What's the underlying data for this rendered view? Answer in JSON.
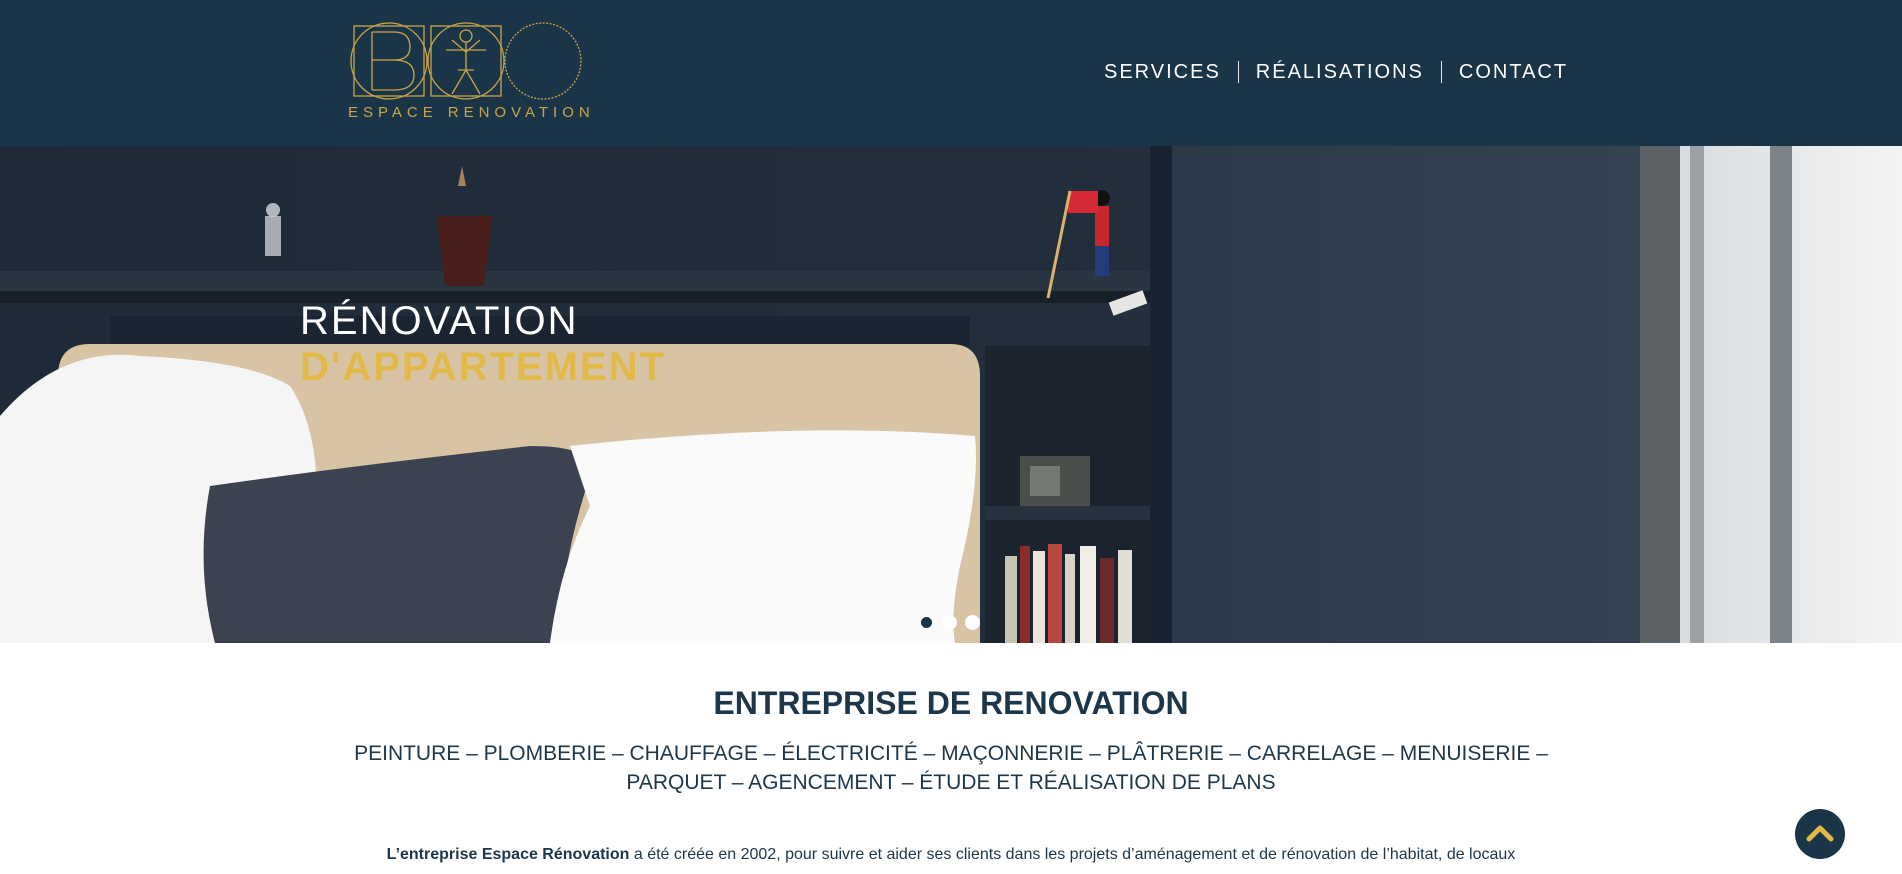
{
  "header": {
    "logo_text_1": "ESPACE",
    "logo_text_2": "RENOVATION",
    "nav": [
      {
        "label": "SERVICES"
      },
      {
        "label": "RÉALISATIONS"
      },
      {
        "label": "CONTACT"
      }
    ]
  },
  "hero": {
    "title_line1": "RÉNOVATION",
    "title_line2": "D'APPARTEMENT",
    "slides_count": 3,
    "active_slide": 1
  },
  "main": {
    "title": "ENTREPRISE DE RENOVATION",
    "services_line1": "PEINTURE – PLOMBERIE – CHAUFFAGE – ÉLECTRICITÉ – MAÇONNERIE – PLÂTRERIE – CARRELAGE – MENUISERIE –",
    "services_line2": "PARQUET – AGENCEMENT – ÉTUDE ET RÉALISATION DE PLANS",
    "intro_bold": "L’entreprise Espace Rénovation",
    "intro_rest": " a été créée en 2002, pour suivre et aider ses clients dans les projets d’aménagement et de rénovation de l’habitat, de locaux"
  },
  "colors": {
    "header_bg": "#1a3547",
    "accent_gold": "#e0b947",
    "logo_gold": "#c9a54a",
    "text_dark": "#1d3649"
  },
  "icons": {
    "scroll_top": "chevron-up-icon"
  }
}
